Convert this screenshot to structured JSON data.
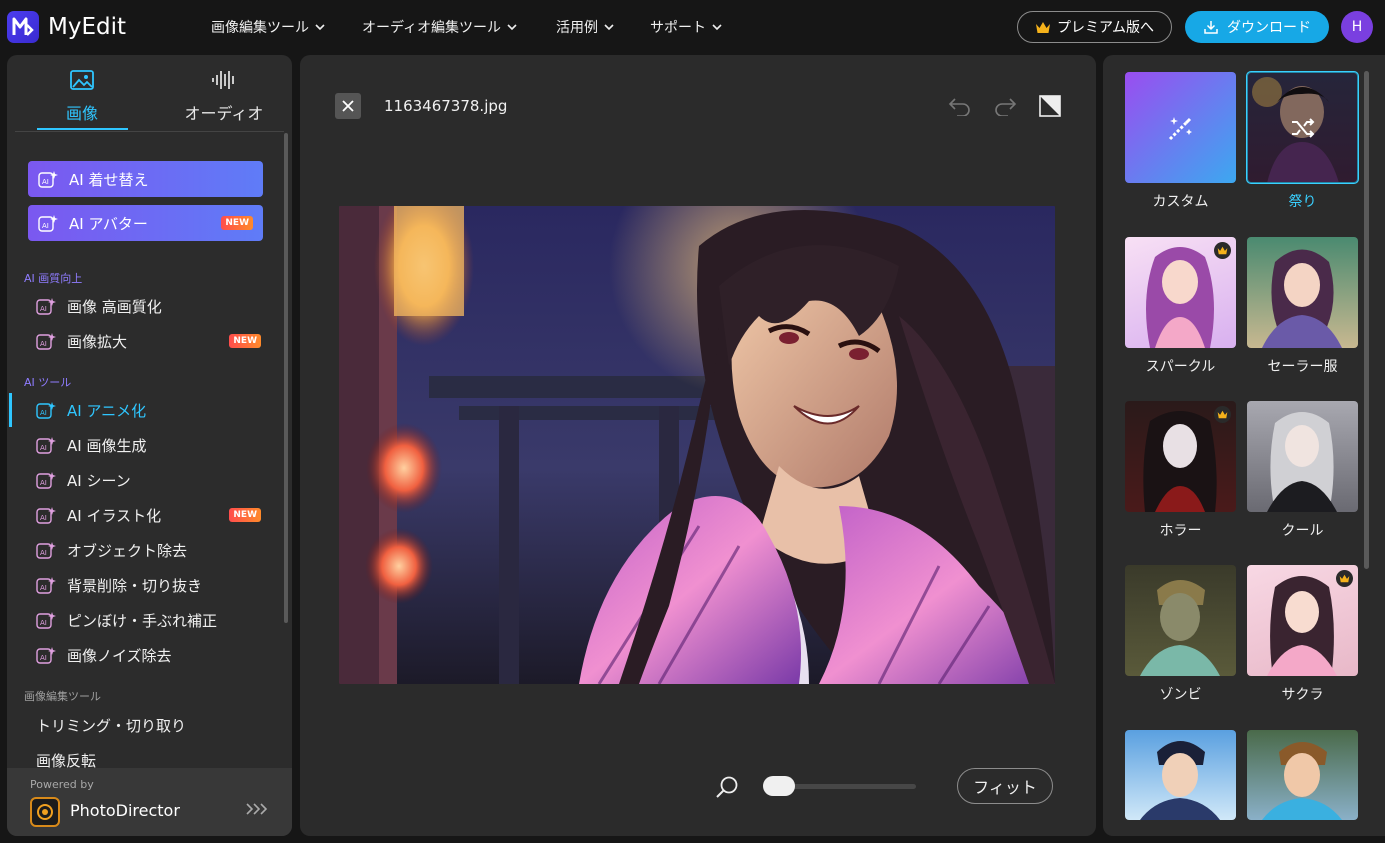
{
  "app": {
    "name": "MyEdit"
  },
  "nav": {
    "items": [
      {
        "label": "画像編集ツール"
      },
      {
        "label": "オーディオ編集ツール"
      },
      {
        "label": "活用例"
      },
      {
        "label": "サポート"
      }
    ],
    "premium_label": "プレミアム版へ",
    "download_label": "ダウンロード",
    "avatar_initial": "H"
  },
  "sidebar": {
    "tabs": [
      {
        "label": "画像",
        "icon": "image-icon",
        "active": true
      },
      {
        "label": "オーディオ",
        "icon": "waveform-icon",
        "active": false
      }
    ],
    "featured": [
      {
        "label": "AI 着せ替え",
        "badge": ""
      },
      {
        "label": "AI アバター",
        "badge": "NEW"
      }
    ],
    "sections": [
      {
        "title": "AI 画質向上",
        "items": [
          {
            "label": "画像 高画質化",
            "badge": ""
          },
          {
            "label": "画像拡大",
            "badge": "NEW"
          }
        ]
      },
      {
        "title": "AI ツール",
        "items": [
          {
            "label": "AI アニメ化",
            "badge": "",
            "active": true
          },
          {
            "label": "AI 画像生成",
            "badge": ""
          },
          {
            "label": "AI シーン",
            "badge": ""
          },
          {
            "label": "AI イラスト化",
            "badge": "NEW"
          },
          {
            "label": "オブジェクト除去",
            "badge": ""
          },
          {
            "label": "背景削除・切り抜き",
            "badge": ""
          },
          {
            "label": "ピンぼけ・手ぶれ補正",
            "badge": ""
          },
          {
            "label": "画像ノイズ除去",
            "badge": ""
          }
        ]
      },
      {
        "title": "画像編集ツール",
        "items": [
          {
            "label": "トリミング・切り取り"
          },
          {
            "label": "画像反転"
          }
        ]
      }
    ],
    "powered_by": "Powered by",
    "powered_name": "PhotoDirector"
  },
  "workspace": {
    "filename": "1163467378.jpg",
    "fit_label": "フィット",
    "zoom_level": 0
  },
  "styles": [
    {
      "label": "カスタム",
      "selected": false,
      "premium": false
    },
    {
      "label": "祭り",
      "selected": true,
      "premium": false
    },
    {
      "label": "スパークル",
      "selected": false,
      "premium": true
    },
    {
      "label": "セーラー服",
      "selected": false,
      "premium": false
    },
    {
      "label": "ホラー",
      "selected": false,
      "premium": true
    },
    {
      "label": "クール",
      "selected": false,
      "premium": false
    },
    {
      "label": "ゾンビ",
      "selected": false,
      "premium": false
    },
    {
      "label": "サクラ",
      "selected": false,
      "premium": true
    }
  ],
  "colors": {
    "accent": "#2fc6ff",
    "download": "#17a8e6",
    "new_badge": "#ff5a3c"
  }
}
